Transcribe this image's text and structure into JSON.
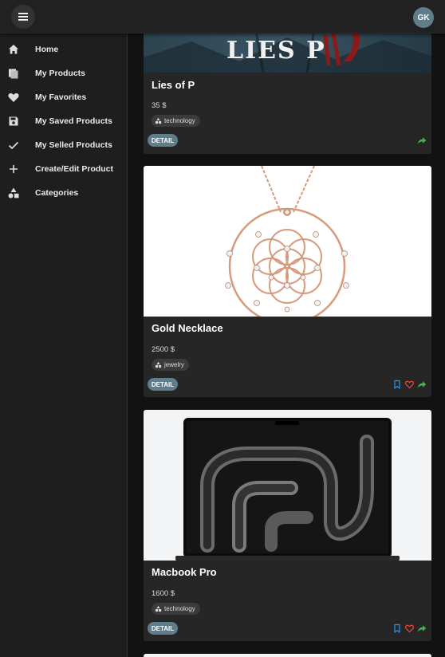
{
  "header": {
    "avatar_initials": "GK",
    "menu_icon": "menu-icon"
  },
  "sidebar": {
    "items": [
      {
        "label": "Home",
        "icon": "home-icon"
      },
      {
        "label": "My Products",
        "icon": "products-icon"
      },
      {
        "label": "My Favorites",
        "icon": "heart-icon"
      },
      {
        "label": "My Saved Products",
        "icon": "save-icon"
      },
      {
        "label": "My Selled Products",
        "icon": "check-icon"
      },
      {
        "label": "Create/Edit Product",
        "icon": "plus-icon"
      },
      {
        "label": "Categories",
        "icon": "category-icon"
      }
    ]
  },
  "products": [
    {
      "name": "Lies of P",
      "price": "35 $",
      "category": "technology",
      "detail_label": "DETAIL",
      "image_text": "LIES P",
      "show_save_fav": false
    },
    {
      "name": "Gold Necklace",
      "price": "2500 $",
      "category": "jewelry",
      "detail_label": "DETAIL",
      "show_save_fav": true
    },
    {
      "name": "Macbook Pro",
      "price": "1600 $",
      "category": "technology",
      "detail_label": "DETAIL",
      "show_save_fav": true
    }
  ],
  "colors": {
    "accent": "#5f7d8b",
    "bookmark": "#2196f3",
    "favorite": "#f44336",
    "share": "#4caf50"
  }
}
